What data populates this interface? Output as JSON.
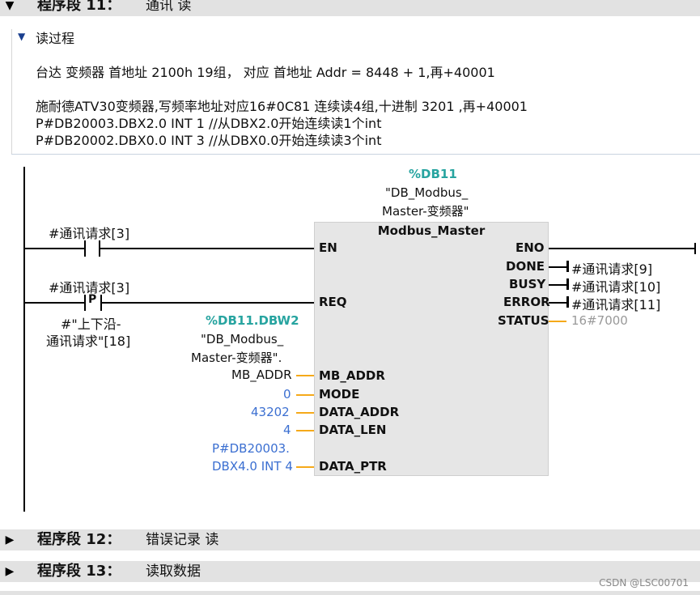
{
  "network11": {
    "label": "程序段 11：",
    "title": "通讯 读"
  },
  "comment": {
    "heading": "读过程",
    "line1": "台达 变频器 首地址 2100h 19组， 对应 首地址 Addr = 8448 + 1,再+40001",
    "line2": "施耐德ATV30变频器,写频率地址对应16#0C81 连续读4组,十进制 3201 ,再+40001",
    "line3": "P#DB20003.DBX2.0 INT 1  //从DBX2.0开始连续读1个int",
    "line4": "P#DB20002.DBX0.0 INT 3  //从DBX0.0开始连续读3个int"
  },
  "block": {
    "instance_db": "%DB11",
    "instance_name_1": "\"DB_Modbus_",
    "instance_name_2": "Master-变频器\"",
    "type": "Modbus_Master",
    "inputs": {
      "en": "EN",
      "req": "REQ",
      "mb_addr": "MB_ADDR",
      "mode": "MODE",
      "data_addr": "DATA_ADDR",
      "data_len": "DATA_LEN",
      "data_ptr": "DATA_PTR"
    },
    "outputs": {
      "eno": "ENO",
      "done": "DONE",
      "busy": "BUSY",
      "error": "ERROR",
      "status": "STATUS"
    }
  },
  "contacts": {
    "en_tag": "#通讯请求[3]",
    "req_tag": "#通讯请求[3]",
    "p_label": "P",
    "edge_tag_1": "#\"上下沿-",
    "edge_tag_2": "通讯请求\"[18]"
  },
  "parameters": {
    "mb_addr_db": "%DB11.DBW2",
    "mb_addr_name_1": "\"DB_Modbus_",
    "mb_addr_name_2": "Master-变频器\".",
    "mb_addr_name_3": "MB_ADDR",
    "mode": "0",
    "data_addr": "43202",
    "data_len": "4",
    "data_ptr_1": "P#DB20003.",
    "data_ptr_2": "DBX4.0 INT 4",
    "done": "#通讯请求[9]",
    "busy": "#通讯请求[10]",
    "error": "#通讯请求[11]",
    "status": "16#7000"
  },
  "network12": {
    "label": "程序段 12：",
    "title": "错误记录 读"
  },
  "network13": {
    "label": "程序段 13：",
    "title": "读取数据"
  },
  "watermark": "CSDN @LSC00701",
  "colors": {
    "header_bg": "#e2e2e2",
    "teal": "#27a4a0",
    "blue": "#3b6fd1",
    "orange": "#f5a91a",
    "status_gray": "#999999"
  }
}
